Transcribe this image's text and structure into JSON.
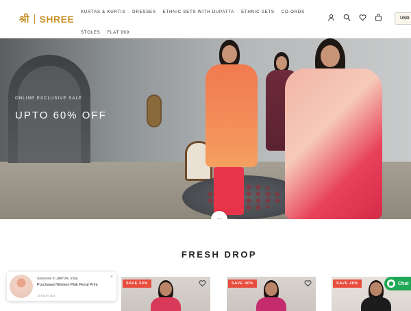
{
  "brand": {
    "mark": "श्री",
    "name": "SHREE",
    "color": "#c9932b"
  },
  "nav": {
    "row1": [
      "KURTAS & KURTIS",
      "DRESSES",
      "ETHNIC SETS WITH DUPATTA",
      "ETHNIC SETS",
      "CO-ORDS"
    ],
    "row2": [
      "STOLES",
      "FLAT 999"
    ]
  },
  "header_icons": [
    "user-icon",
    "search-icon",
    "heart-icon",
    "cart-icon"
  ],
  "currency": "USD",
  "hero": {
    "eyebrow": "ONLINE EXCLUSIVE SALE",
    "headline": "UPTO 60% OFF"
  },
  "section": {
    "title": "FRESH DROP"
  },
  "products": [
    {
      "badge": "SAVE 50%"
    },
    {
      "badge": "SAVE 40%"
    },
    {
      "badge": "SAVE 40%"
    }
  ],
  "popup": {
    "line1": "Someone in JAIPUR, India",
    "line2": "Purchased Women Pink Floral Print",
    "line3": "19 hours ago"
  },
  "chat": {
    "label": "Chat"
  },
  "colors": {
    "badge": "#e74c3c",
    "chat": "#1fa855"
  }
}
